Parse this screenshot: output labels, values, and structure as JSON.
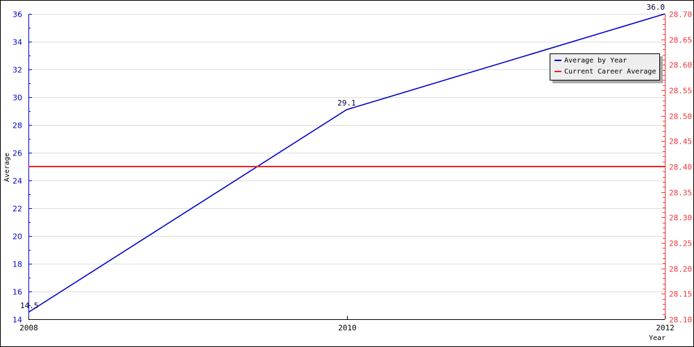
{
  "chart_data": {
    "type": "line",
    "title": "",
    "xlabel": "Year",
    "ylabel": "Average",
    "x": [
      2008,
      2010,
      2012
    ],
    "x_ticks": [
      "2008",
      "2010",
      "2012"
    ],
    "xlim": [
      2008,
      2012
    ],
    "ylim": [
      14,
      36
    ],
    "y_ticks": [
      "14",
      "16",
      "18",
      "20",
      "22",
      "24",
      "26",
      "28",
      "30",
      "32",
      "34",
      "36"
    ],
    "y2lim": [
      28.1,
      28.7
    ],
    "y2_ticks": [
      "28.10",
      "28.15",
      "28.20",
      "28.25",
      "28.30",
      "28.35",
      "28.40",
      "28.45",
      "28.50",
      "28.55",
      "28.60",
      "28.65",
      "28.70"
    ],
    "grid": true,
    "legend_position": "top-right",
    "series": [
      {
        "name": "Average by Year",
        "axis": "left",
        "color": "#0000cc",
        "values": [
          14.5,
          29.1,
          36.0
        ],
        "labels": [
          "14.5",
          "29.1",
          "36.0"
        ]
      },
      {
        "name": "Current Career Average",
        "axis": "right",
        "color": "#ee2222",
        "values": [
          28.4,
          28.4,
          28.4
        ]
      }
    ]
  },
  "legend": {
    "items": [
      {
        "label": "Average by Year",
        "color": "#0000cc"
      },
      {
        "label": "Current Career Average",
        "color": "#ee2222"
      }
    ]
  }
}
